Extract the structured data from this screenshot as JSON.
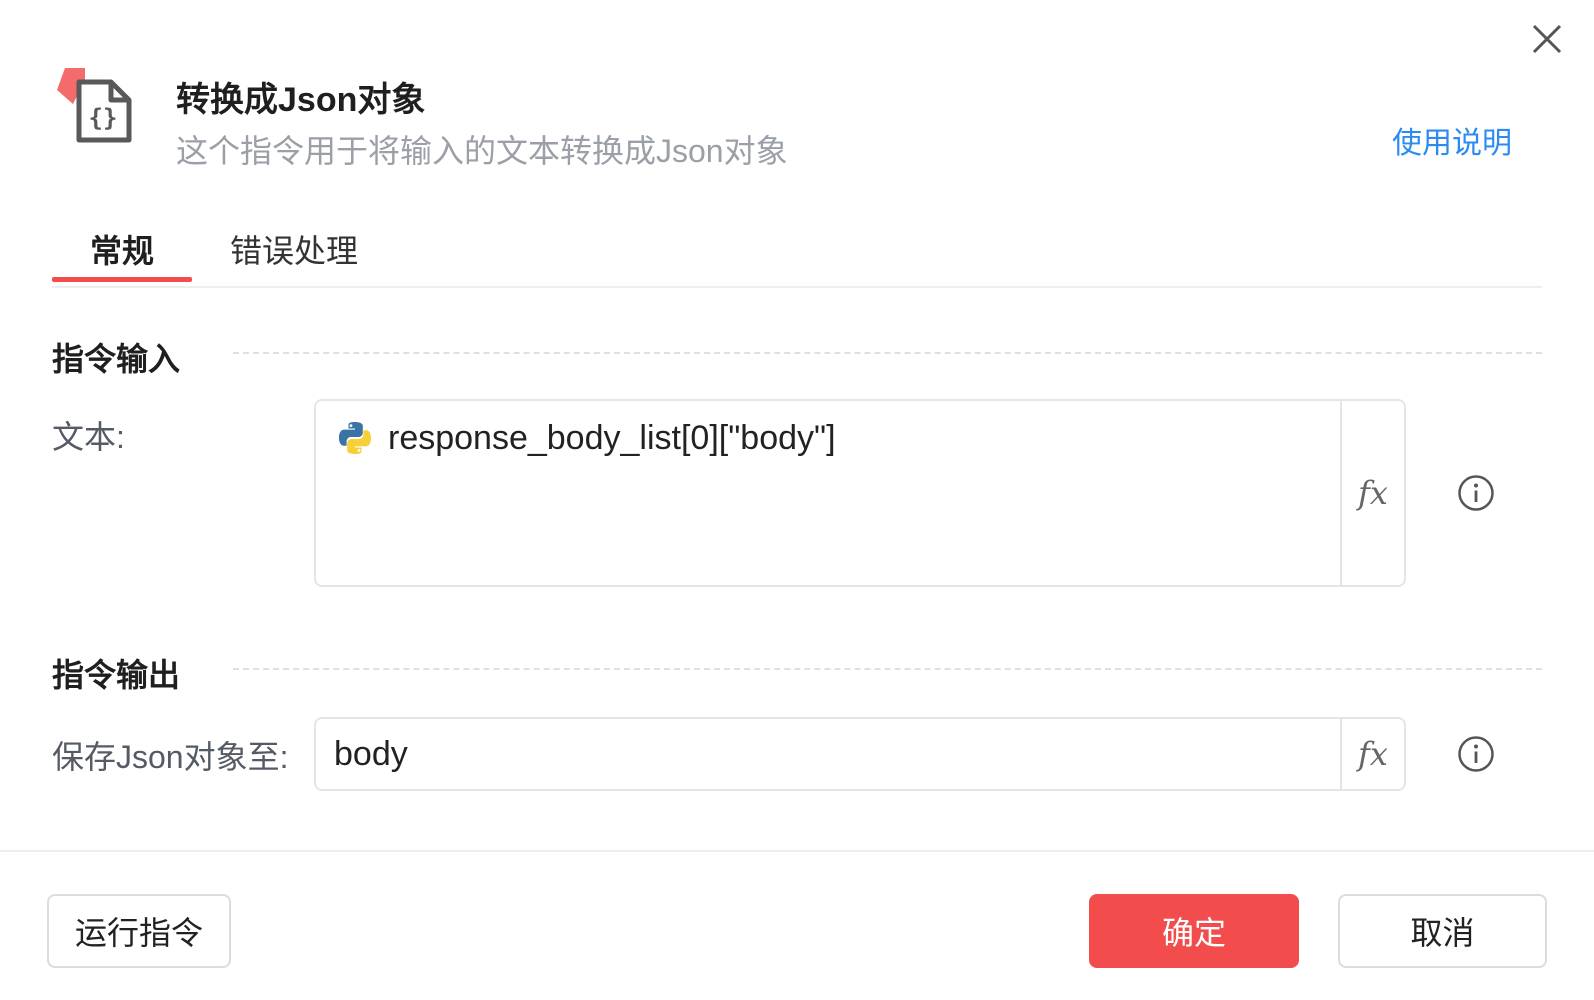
{
  "dialog": {
    "title": "转换成Json对象",
    "subtitle": "这个指令用于将输入的文本转换成Json对象",
    "help_link": "使用说明",
    "icon": "json-file-icon",
    "close_icon": "close-icon",
    "accent_color": "#f24c4c",
    "link_color": "#2c8bf0"
  },
  "tabs": [
    {
      "label": "常规",
      "active": true
    },
    {
      "label": "错误处理",
      "active": false
    }
  ],
  "input_section": {
    "title": "指令输入",
    "text_field": {
      "label": "文本:",
      "value": "response_body_list[0][\"body\"]",
      "prefix_icon": "python-icon",
      "fx_label": "fx",
      "info_icon": "info-icon"
    }
  },
  "output_section": {
    "title": "指令输出",
    "save_field": {
      "label": "保存Json对象至:",
      "value": "body",
      "fx_label": "fx",
      "info_icon": "info-icon"
    }
  },
  "footer": {
    "run_label": "运行指令",
    "ok_label": "确定",
    "cancel_label": "取消"
  }
}
